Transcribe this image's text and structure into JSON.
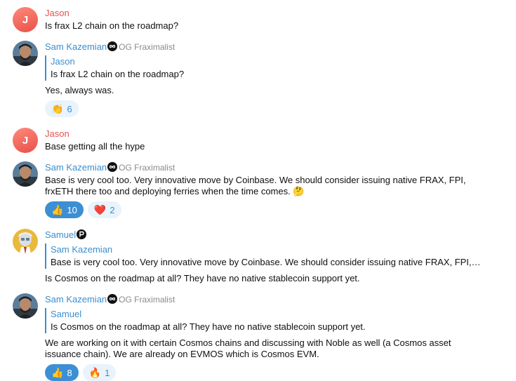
{
  "messages": [
    {
      "author": "Jason",
      "avatar_letter": "J",
      "text": "Is frax L2 chain on the roadmap?"
    },
    {
      "author": "Sam Kazemian",
      "rank": "OG Fraximalist",
      "badge_icon": "infinity-badge-icon",
      "quote_author": "Jason",
      "quote_text": "Is frax L2 chain on the roadmap?",
      "text": "Yes, always was.",
      "reactions": [
        {
          "emoji": "👏",
          "count": "6",
          "active": false
        }
      ]
    },
    {
      "author": "Jason",
      "avatar_letter": "J",
      "text": "Base getting all the hype"
    },
    {
      "author": "Sam Kazemian",
      "rank": "OG Fraximalist",
      "badge_icon": "infinity-badge-icon",
      "text_line1": "Base is very cool too. Very innovative move by Coinbase. We should consider issuing native FRAX, FPI,",
      "text_line2": "frxETH there too and deploying ferries when the time comes. 🤔",
      "reactions": [
        {
          "emoji": "👍",
          "count": "10",
          "active": true
        },
        {
          "emoji": "❤️",
          "count": "2",
          "active": false
        }
      ]
    },
    {
      "author": "Samuel",
      "badge_icon": "p-badge-icon",
      "quote_author": "Sam Kazemian",
      "quote_text": "Base is very cool too. Very innovative move by Coinbase. We should consider issuing native FRAX, FPI,…",
      "text": "Is Cosmos on the roadmap at all? They have no native stablecoin support yet."
    },
    {
      "author": "Sam Kazemian",
      "rank": "OG Fraximalist",
      "badge_icon": "infinity-badge-icon",
      "quote_author": "Samuel",
      "quote_text": "Is Cosmos on the roadmap at all? They have no native stablecoin support yet.",
      "text_line1": "We are working on it with certain Cosmos chains and discussing with Noble as well (a Cosmos asset",
      "text_line2": "issuance chain). We are already on EVMOS which is Cosmos EVM.",
      "reactions": [
        {
          "emoji": "👍",
          "count": "8",
          "active": true
        },
        {
          "emoji": "🔥",
          "count": "1",
          "active": false
        }
      ]
    }
  ],
  "colors": {
    "name_red": "#e25350",
    "name_blue": "#3a8fcf",
    "reaction_active": "#3c8fd4",
    "reaction_light": "#e9f3fb"
  }
}
